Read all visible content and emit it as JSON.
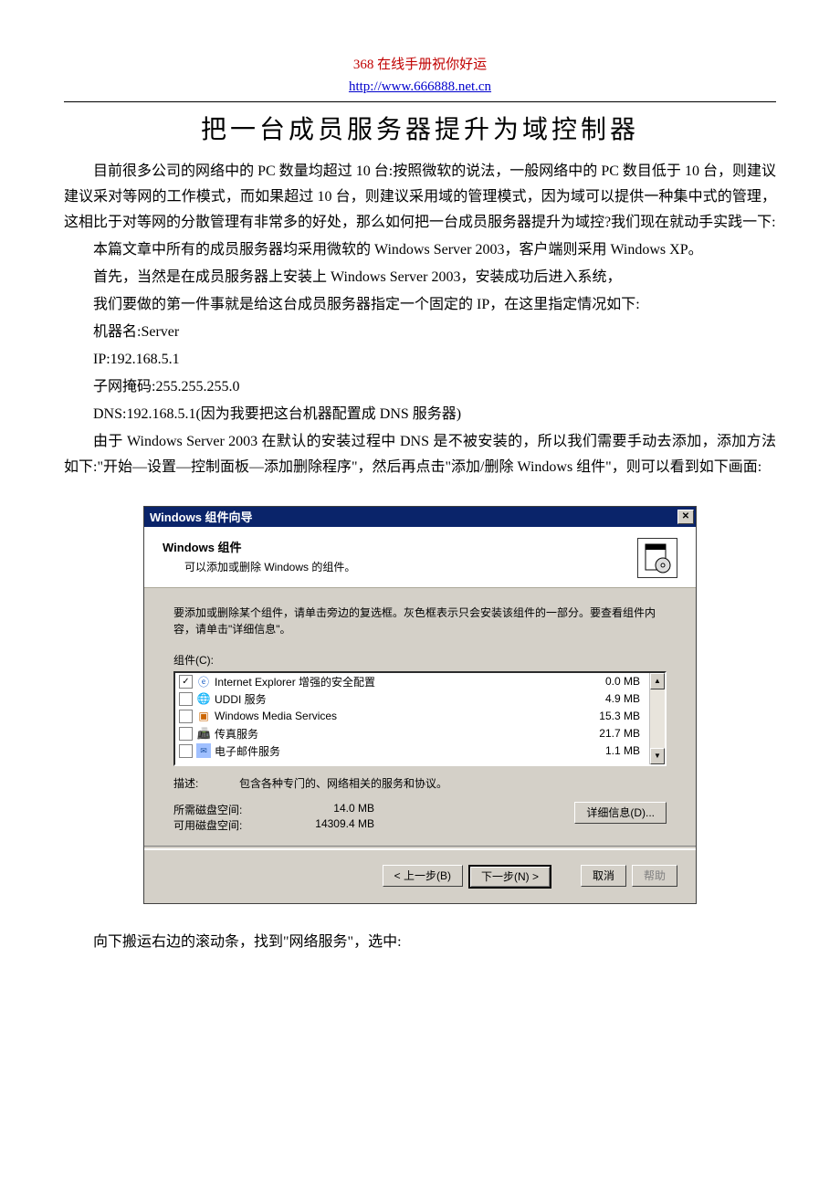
{
  "header": {
    "red_text": "368 在线手册祝你好运",
    "url": "http://www.666888.net.cn"
  },
  "title": "把一台成员服务器提升为域控制器",
  "paragraphs": {
    "p1": "目前很多公司的网络中的 PC 数量均超过 10 台:按照微软的说法，一般网络中的 PC 数目低于 10 台，则建议建议采对等网的工作模式，而如果超过 10 台，则建议采用域的管理模式，因为域可以提供一种集中式的管理，这相比于对等网的分散管理有非常多的好处，那么如何把一台成员服务器提升为域控?我们现在就动手实践一下:",
    "p2": "本篇文章中所有的成员服务器均采用微软的 Windows Server 2003，客户端则采用 Windows XP。",
    "p3": "首先，当然是在成员服务器上安装上 Windows Server 2003，安装成功后进入系统，",
    "p4": "我们要做的第一件事就是给这台成员服务器指定一个固定的 IP，在这里指定情况如下:",
    "p5": "机器名:Server",
    "p6": "IP:192.168.5.1",
    "p7": "子网掩码:255.255.255.0",
    "p8": "DNS:192.168.5.1(因为我要把这台机器配置成 DNS 服务器)",
    "p9": "由于 Windows Server 2003 在默认的安装过程中 DNS 是不被安装的，所以我们需要手动去添加，添加方法如下:\"开始—设置—控制面板—添加删除程序\"，然后再点击\"添加/删除 Windows 组件\"，则可以看到如下画面:",
    "p_after": "向下搬运右边的滚动条，找到\"网络服务\"，选中:"
  },
  "dialog": {
    "titlebar": "Windows 组件向导",
    "header_title": "Windows 组件",
    "header_sub": "可以添加或删除 Windows 的组件。",
    "instruction": "要添加或删除某个组件，请单击旁边的复选框。灰色框表示只会安装该组件的一部分。要查看组件内容，请单击\"详细信息\"。",
    "components_label": "组件(C):",
    "rows": [
      {
        "checked": true,
        "icon": "ie",
        "name": "Internet Explorer 增强的安全配置",
        "size": "0.0 MB"
      },
      {
        "checked": false,
        "icon": "globe",
        "name": "UDDI 服务",
        "size": "4.9 MB"
      },
      {
        "checked": false,
        "icon": "wms",
        "name": "Windows Media Services",
        "size": "15.3 MB"
      },
      {
        "checked": false,
        "icon": "fax",
        "name": "传真服务",
        "size": "21.7 MB"
      },
      {
        "checked": false,
        "icon": "mail",
        "name": "电子邮件服务",
        "size": "1.1 MB"
      }
    ],
    "desc_label": "描述:",
    "desc_value": "包含各种专门的、网络相关的服务和协议。",
    "space_req_label": "所需磁盘空间:",
    "space_req_value": "14.0 MB",
    "space_avail_label": "可用磁盘空间:",
    "space_avail_value": "14309.4 MB",
    "details_btn": "详细信息(D)...",
    "back_btn": "< 上一步(B)",
    "next_btn": "下一步(N) >",
    "cancel_btn": "取消",
    "help_btn": "帮助"
  }
}
